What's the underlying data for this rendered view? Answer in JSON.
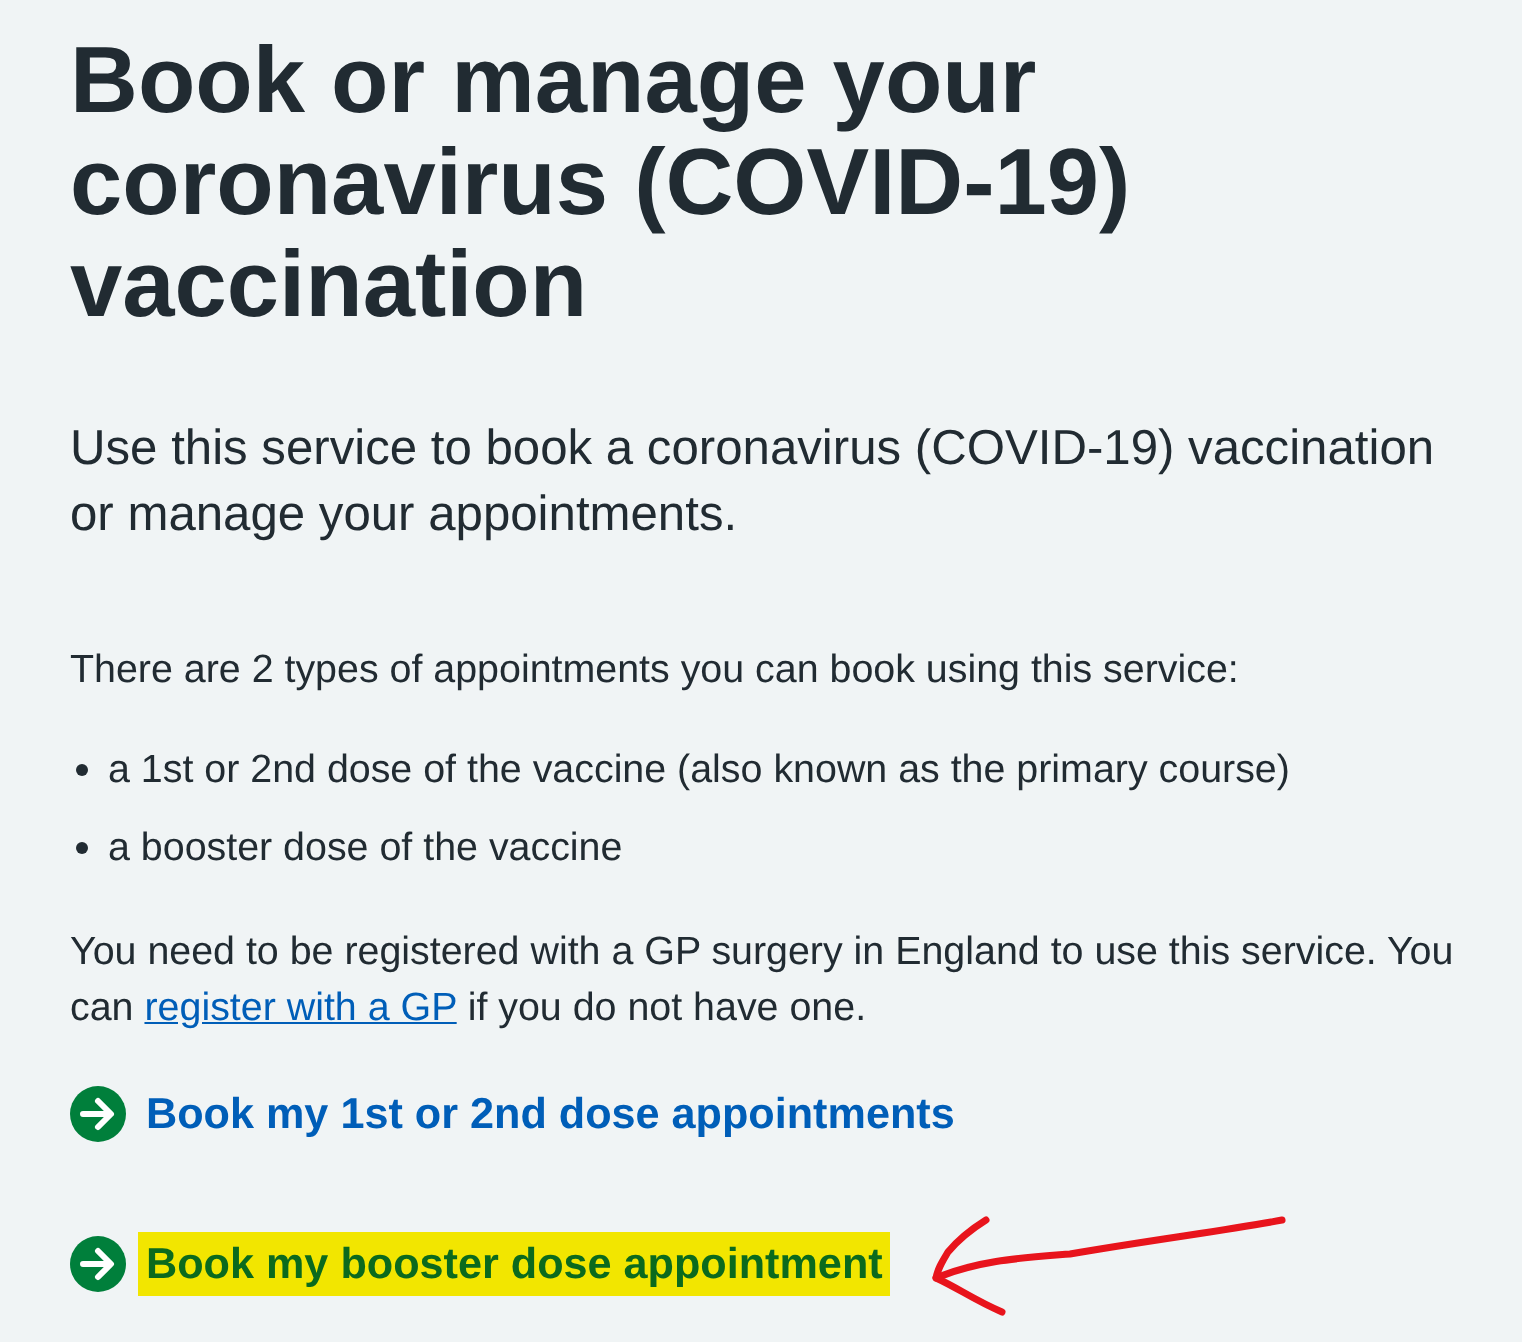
{
  "heading": "Book or manage your coronavirus (COVID-19) vaccination",
  "lead": "Use this service to book a coronavirus (COVID-19) vaccination or manage your appointments.",
  "intro": "There are 2 types of appointments you can book using this service:",
  "list_items": [
    "a 1st or 2nd dose of the vaccine (also known as the primary course)",
    "a booster dose of the vaccine"
  ],
  "registration_note": {
    "text_before": "You need to be registered with a GP surgery in England to use this service. You can",
    "link": "register with a GP",
    "text_after": "if you do not have one."
  },
  "action_links": [
    {
      "label": "Book my 1st or 2nd dose appointments",
      "highlighted": false,
      "arrow": false
    },
    {
      "label": "Book my booster dose appointment",
      "highlighted": true,
      "arrow": true
    }
  ]
}
